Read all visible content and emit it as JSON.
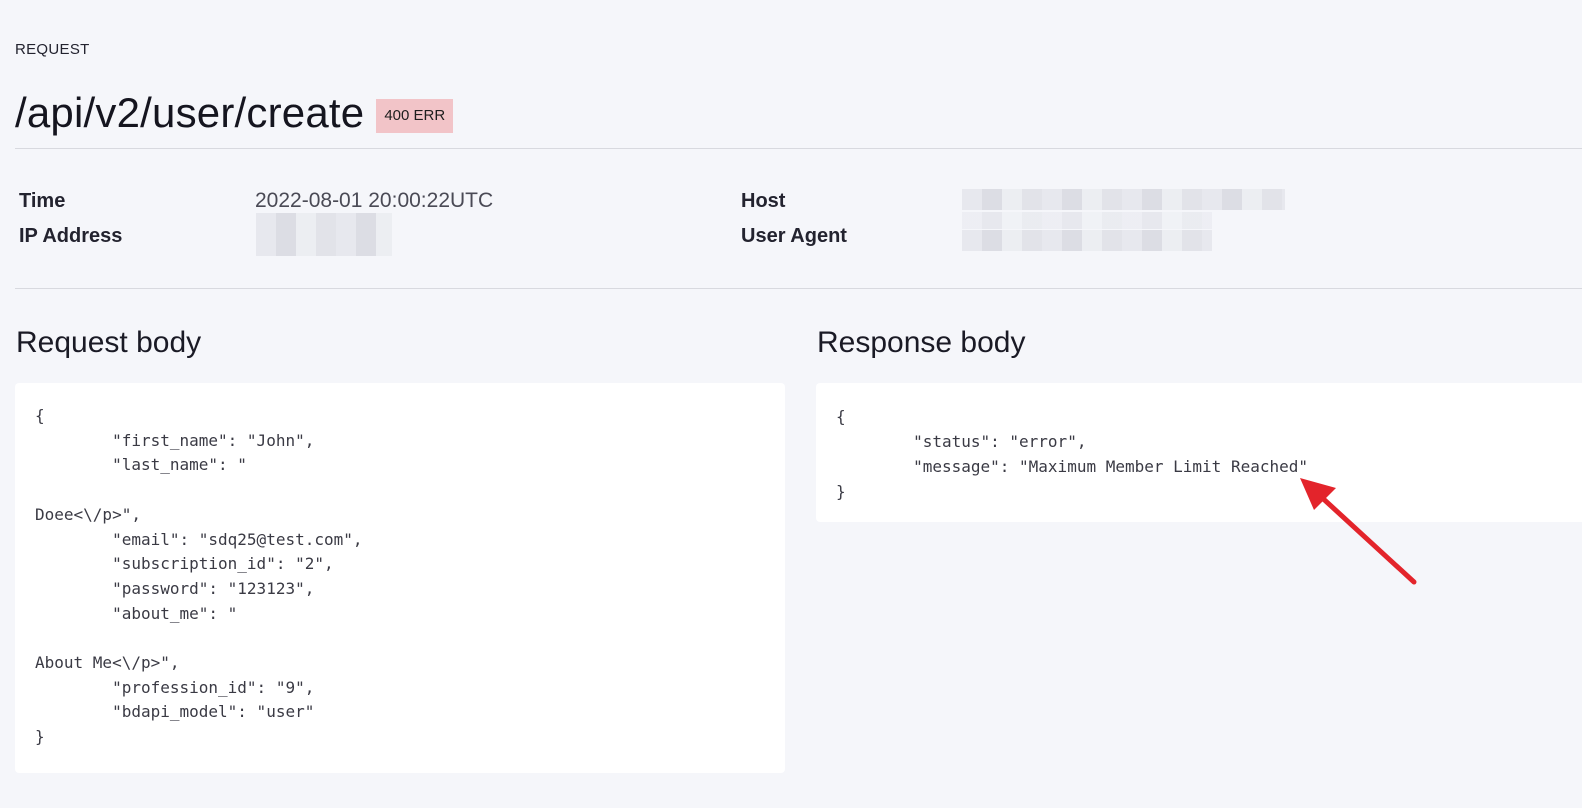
{
  "header": {
    "kicker": "REQUEST",
    "endpoint": "/api/v2/user/create",
    "status_badge": "400 ERR"
  },
  "meta": {
    "time_label": "Time",
    "time_value": "2022-08-01 20:00:22UTC",
    "ip_label": "IP Address",
    "host_label": "Host",
    "user_agent_label": "User Agent"
  },
  "request": {
    "title": "Request body",
    "body": "{\n        \"first_name\": \"John\",\n        \"last_name\": \"\n\nDoee<\\/p>\",\n        \"email\": \"sdq25@test.com\",\n        \"subscription_id\": \"2\",\n        \"password\": \"123123\",\n        \"about_me\": \"\n\nAbout Me<\\/p>\",\n        \"profession_id\": \"9\",\n        \"bdapi_model\": \"user\"\n}"
  },
  "response": {
    "title": "Response body",
    "body": "{\n        \"status\": \"error\",\n        \"message\": \"Maximum Member Limit Reached\"\n}"
  },
  "colors": {
    "badge_bg": "#f2c4c8",
    "arrow": "#e3242b",
    "page_bg": "#f5f6fa"
  },
  "icons": {
    "annotation": "red-arrow-icon"
  }
}
